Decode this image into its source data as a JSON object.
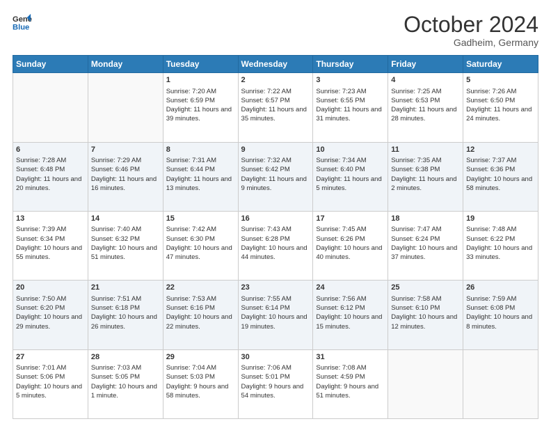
{
  "header": {
    "logo_line1": "General",
    "logo_line2": "Blue",
    "month": "October 2024",
    "location": "Gadheim, Germany"
  },
  "weekdays": [
    "Sunday",
    "Monday",
    "Tuesday",
    "Wednesday",
    "Thursday",
    "Friday",
    "Saturday"
  ],
  "weeks": [
    [
      {
        "day": "",
        "sunrise": "",
        "sunset": "",
        "daylight": ""
      },
      {
        "day": "",
        "sunrise": "",
        "sunset": "",
        "daylight": ""
      },
      {
        "day": "1",
        "sunrise": "Sunrise: 7:20 AM",
        "sunset": "Sunset: 6:59 PM",
        "daylight": "Daylight: 11 hours and 39 minutes."
      },
      {
        "day": "2",
        "sunrise": "Sunrise: 7:22 AM",
        "sunset": "Sunset: 6:57 PM",
        "daylight": "Daylight: 11 hours and 35 minutes."
      },
      {
        "day": "3",
        "sunrise": "Sunrise: 7:23 AM",
        "sunset": "Sunset: 6:55 PM",
        "daylight": "Daylight: 11 hours and 31 minutes."
      },
      {
        "day": "4",
        "sunrise": "Sunrise: 7:25 AM",
        "sunset": "Sunset: 6:53 PM",
        "daylight": "Daylight: 11 hours and 28 minutes."
      },
      {
        "day": "5",
        "sunrise": "Sunrise: 7:26 AM",
        "sunset": "Sunset: 6:50 PM",
        "daylight": "Daylight: 11 hours and 24 minutes."
      }
    ],
    [
      {
        "day": "6",
        "sunrise": "Sunrise: 7:28 AM",
        "sunset": "Sunset: 6:48 PM",
        "daylight": "Daylight: 11 hours and 20 minutes."
      },
      {
        "day": "7",
        "sunrise": "Sunrise: 7:29 AM",
        "sunset": "Sunset: 6:46 PM",
        "daylight": "Daylight: 11 hours and 16 minutes."
      },
      {
        "day": "8",
        "sunrise": "Sunrise: 7:31 AM",
        "sunset": "Sunset: 6:44 PM",
        "daylight": "Daylight: 11 hours and 13 minutes."
      },
      {
        "day": "9",
        "sunrise": "Sunrise: 7:32 AM",
        "sunset": "Sunset: 6:42 PM",
        "daylight": "Daylight: 11 hours and 9 minutes."
      },
      {
        "day": "10",
        "sunrise": "Sunrise: 7:34 AM",
        "sunset": "Sunset: 6:40 PM",
        "daylight": "Daylight: 11 hours and 5 minutes."
      },
      {
        "day": "11",
        "sunrise": "Sunrise: 7:35 AM",
        "sunset": "Sunset: 6:38 PM",
        "daylight": "Daylight: 11 hours and 2 minutes."
      },
      {
        "day": "12",
        "sunrise": "Sunrise: 7:37 AM",
        "sunset": "Sunset: 6:36 PM",
        "daylight": "Daylight: 10 hours and 58 minutes."
      }
    ],
    [
      {
        "day": "13",
        "sunrise": "Sunrise: 7:39 AM",
        "sunset": "Sunset: 6:34 PM",
        "daylight": "Daylight: 10 hours and 55 minutes."
      },
      {
        "day": "14",
        "sunrise": "Sunrise: 7:40 AM",
        "sunset": "Sunset: 6:32 PM",
        "daylight": "Daylight: 10 hours and 51 minutes."
      },
      {
        "day": "15",
        "sunrise": "Sunrise: 7:42 AM",
        "sunset": "Sunset: 6:30 PM",
        "daylight": "Daylight: 10 hours and 47 minutes."
      },
      {
        "day": "16",
        "sunrise": "Sunrise: 7:43 AM",
        "sunset": "Sunset: 6:28 PM",
        "daylight": "Daylight: 10 hours and 44 minutes."
      },
      {
        "day": "17",
        "sunrise": "Sunrise: 7:45 AM",
        "sunset": "Sunset: 6:26 PM",
        "daylight": "Daylight: 10 hours and 40 minutes."
      },
      {
        "day": "18",
        "sunrise": "Sunrise: 7:47 AM",
        "sunset": "Sunset: 6:24 PM",
        "daylight": "Daylight: 10 hours and 37 minutes."
      },
      {
        "day": "19",
        "sunrise": "Sunrise: 7:48 AM",
        "sunset": "Sunset: 6:22 PM",
        "daylight": "Daylight: 10 hours and 33 minutes."
      }
    ],
    [
      {
        "day": "20",
        "sunrise": "Sunrise: 7:50 AM",
        "sunset": "Sunset: 6:20 PM",
        "daylight": "Daylight: 10 hours and 29 minutes."
      },
      {
        "day": "21",
        "sunrise": "Sunrise: 7:51 AM",
        "sunset": "Sunset: 6:18 PM",
        "daylight": "Daylight: 10 hours and 26 minutes."
      },
      {
        "day": "22",
        "sunrise": "Sunrise: 7:53 AM",
        "sunset": "Sunset: 6:16 PM",
        "daylight": "Daylight: 10 hours and 22 minutes."
      },
      {
        "day": "23",
        "sunrise": "Sunrise: 7:55 AM",
        "sunset": "Sunset: 6:14 PM",
        "daylight": "Daylight: 10 hours and 19 minutes."
      },
      {
        "day": "24",
        "sunrise": "Sunrise: 7:56 AM",
        "sunset": "Sunset: 6:12 PM",
        "daylight": "Daylight: 10 hours and 15 minutes."
      },
      {
        "day": "25",
        "sunrise": "Sunrise: 7:58 AM",
        "sunset": "Sunset: 6:10 PM",
        "daylight": "Daylight: 10 hours and 12 minutes."
      },
      {
        "day": "26",
        "sunrise": "Sunrise: 7:59 AM",
        "sunset": "Sunset: 6:08 PM",
        "daylight": "Daylight: 10 hours and 8 minutes."
      }
    ],
    [
      {
        "day": "27",
        "sunrise": "Sunrise: 7:01 AM",
        "sunset": "Sunset: 5:06 PM",
        "daylight": "Daylight: 10 hours and 5 minutes."
      },
      {
        "day": "28",
        "sunrise": "Sunrise: 7:03 AM",
        "sunset": "Sunset: 5:05 PM",
        "daylight": "Daylight: 10 hours and 1 minute."
      },
      {
        "day": "29",
        "sunrise": "Sunrise: 7:04 AM",
        "sunset": "Sunset: 5:03 PM",
        "daylight": "Daylight: 9 hours and 58 minutes."
      },
      {
        "day": "30",
        "sunrise": "Sunrise: 7:06 AM",
        "sunset": "Sunset: 5:01 PM",
        "daylight": "Daylight: 9 hours and 54 minutes."
      },
      {
        "day": "31",
        "sunrise": "Sunrise: 7:08 AM",
        "sunset": "Sunset: 4:59 PM",
        "daylight": "Daylight: 9 hours and 51 minutes."
      },
      {
        "day": "",
        "sunrise": "",
        "sunset": "",
        "daylight": ""
      },
      {
        "day": "",
        "sunrise": "",
        "sunset": "",
        "daylight": ""
      }
    ]
  ]
}
